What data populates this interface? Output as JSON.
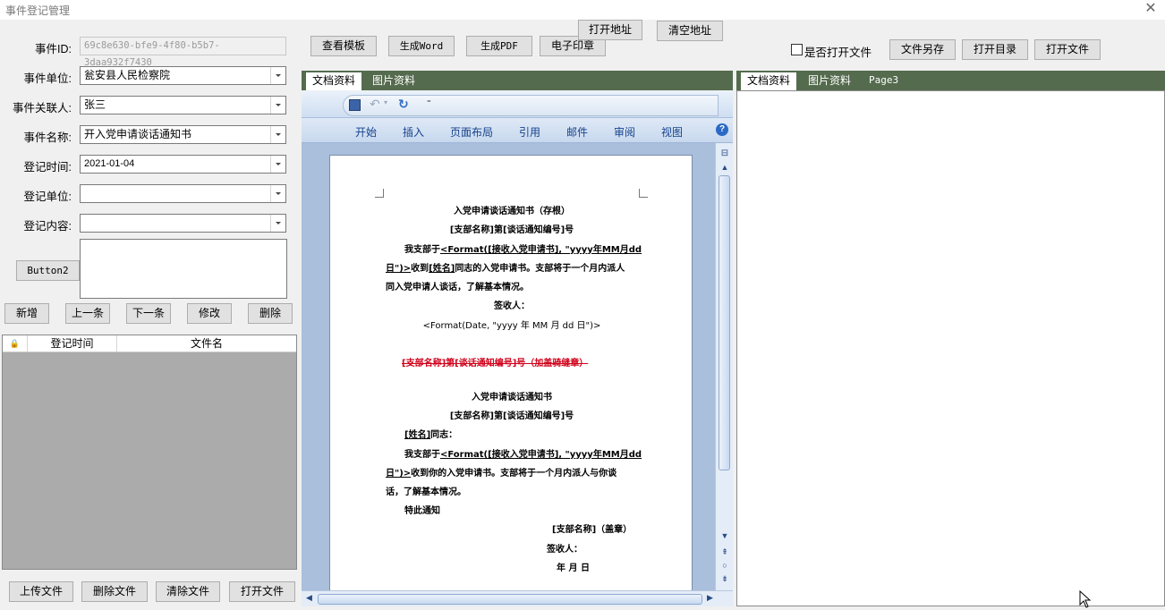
{
  "window": {
    "title": "事件登记管理"
  },
  "form": {
    "event_id_label": "事件ID:",
    "event_id_value": "69c8e630-bfe9-4f80-b5b7-3daa932f7430",
    "event_unit_label": "事件单位:",
    "event_unit_value": "瓮安县人民检察院",
    "contact_label": "事件关联人:",
    "contact_value": "张三",
    "event_name_label": "事件名称:",
    "event_name_value": "开入党申请谈话通知书",
    "reg_time_label": "登记时间:",
    "reg_time_value": "2021-01-04",
    "reg_unit_label": "登记单位:",
    "reg_unit_value": "",
    "reg_content_label": "登记内容:",
    "reg_content_value": "",
    "button2": "Button2"
  },
  "nav_buttons": {
    "add": "新增",
    "prev": "上一条",
    "next": "下一条",
    "edit": "修改",
    "delete": "删除"
  },
  "grid": {
    "columns": [
      "登记时间",
      "文件名"
    ]
  },
  "file_buttons": {
    "upload": "上传文件",
    "delete": "删除文件",
    "clear": "清除文件",
    "open": "打开文件"
  },
  "top_buttons": {
    "view_template": "查看模板",
    "gen_word": "生成Word",
    "gen_pdf": "生成PDF",
    "e_seal": "电子印章",
    "open_address": "打开地址",
    "clear_address": "清空地址",
    "open_file_check": "是否打开文件",
    "save_as": "文件另存",
    "open_dir": "打开目录",
    "open_file": "打开文件"
  },
  "middle_tabs": [
    "文档资料",
    "图片资料"
  ],
  "right_tabs": [
    "文档资料",
    "图片资料",
    "Page3"
  ],
  "ribbon_tabs": [
    "开始",
    "插入",
    "页面布局",
    "引用",
    "邮件",
    "审阅",
    "视图"
  ],
  "document": {
    "l1": "入党申请谈话通知书（存根）",
    "l2": "[支部名称]第[谈话通知编号]号",
    "l3a": "我支部于",
    "l3b": "<Format([接收入党申请书], \"yyyy年MM月dd",
    "l4a": "日\")>",
    "l4b": "收到",
    "l4c": "[姓名]",
    "l4d": "同志的入党申请书。支部将于一个月内派人",
    "l5": "同入党申请人谈话，了解基本情况。",
    "l6": "签收人：",
    "l7": "<Format(Date, \"yyyy 年 MM 月 dd 日\")>",
    "l8": "[支部名称]第[谈话通知编号]号（加盖骑缝章）",
    "l9": "入党申请谈话通知书",
    "l10": "[支部名称]第[谈话通知编号]号",
    "l11a": "[姓名]",
    "l11b": "同志：",
    "l12a": "我支部于",
    "l12b": "<Format([接收入党申请书], \"yyyy年MM月dd",
    "l13a": "日\")>",
    "l13b": "收到你的入党申请书。支部将于一个月内派人与你谈",
    "l14": "话，了解基本情况。",
    "l15": "特此通知",
    "l16": "[支部名称]（盖章）",
    "l17": "签收人：",
    "l18": "年  月 日"
  },
  "colors": {
    "tab_bar": "#556b4e",
    "word_blue": "#15428b",
    "strike_red": "#d0021b"
  }
}
